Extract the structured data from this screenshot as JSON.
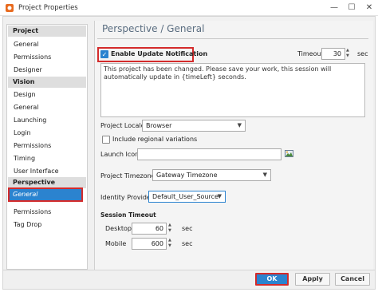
{
  "window": {
    "title": "Project Properties",
    "controls": {
      "minimize": "—",
      "maximize": "☐",
      "close": "✕"
    }
  },
  "sidebar": {
    "sections": [
      {
        "header": "Project",
        "items": [
          "General",
          "Permissions",
          "Designer"
        ]
      },
      {
        "header": "Vision",
        "items": [
          "Design",
          "General",
          "Launching",
          "Login",
          "Permissions",
          "Timing",
          "User Interface"
        ]
      },
      {
        "header": "Perspective",
        "items": [
          "General",
          "Permissions",
          "Tag Drop"
        ]
      }
    ],
    "selected": "General"
  },
  "main": {
    "title": "Perspective / General",
    "update_notification": {
      "label": "Enable Update Notification",
      "checked": true,
      "timeout_label": "Timeout",
      "timeout_value": "30",
      "timeout_unit": "sec",
      "message": "This project has been changed. Please save your work, this session will automatically update in {timeLeft} seconds."
    },
    "project_locale": {
      "label": "Project Locale",
      "value": "Browser"
    },
    "include_regional": {
      "label": "Include regional variations",
      "checked": false
    },
    "launch_icon": {
      "label": "Launch Icon",
      "value": ""
    },
    "project_timezone": {
      "label": "Project Timezone",
      "value": "Gateway Timezone"
    },
    "identity_provider": {
      "label": "Identity Provider",
      "value": "Default_User_Source"
    },
    "session_timeout": {
      "label": "Session Timeout",
      "desktop": {
        "label": "Desktop",
        "value": "60",
        "unit": "sec"
      },
      "mobile": {
        "label": "Mobile",
        "value": "600",
        "unit": "sec"
      }
    }
  },
  "buttons": {
    "ok": "OK",
    "apply": "Apply",
    "cancel": "Cancel"
  },
  "colors": {
    "accent": "#2b83cf",
    "highlight": "#d42b2b",
    "title": "#5a6d80"
  },
  "icons": [
    "app-icon",
    "chevron-down-icon",
    "spinner-icon",
    "image-browse-icon"
  ]
}
